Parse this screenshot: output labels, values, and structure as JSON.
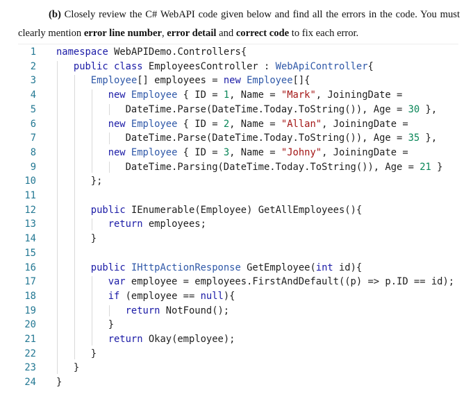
{
  "question": {
    "label": "(b)",
    "text_before": " Closely review the C# WebAPI code given below and find all the errors in the code. You must",
    "text_line2_start": "clearly mention ",
    "bold1": "error line number",
    "sep1": ", ",
    "bold2": "error detail",
    "sep2": " and ",
    "bold3": "correct code",
    "text_end": " to fix each error."
  },
  "code": {
    "language": "C#",
    "lines": [
      {
        "n": "1",
        "indent": 0,
        "tokens": [
          [
            "kw",
            "namespace"
          ],
          [
            "",
            " WebAPIDemo.Controllers{"
          ]
        ]
      },
      {
        "n": "2",
        "indent": 1,
        "tokens": [
          [
            "kw",
            "public class"
          ],
          [
            "",
            " EmployeesController : "
          ],
          [
            "ty",
            "WebApiController"
          ],
          [
            "",
            "{"
          ]
        ]
      },
      {
        "n": "3",
        "indent": 2,
        "tokens": [
          [
            "ty",
            "Employee"
          ],
          [
            "",
            "[] employees = "
          ],
          [
            "kw",
            "new"
          ],
          [
            "",
            " "
          ],
          [
            "ty",
            "Employee"
          ],
          [
            "",
            "[]{"
          ]
        ]
      },
      {
        "n": "4",
        "indent": 3,
        "tokens": [
          [
            "kw",
            "new"
          ],
          [
            "",
            " "
          ],
          [
            "ty",
            "Employee"
          ],
          [
            "",
            " { ID = "
          ],
          [
            "num",
            "1"
          ],
          [
            "",
            ", Name = "
          ],
          [
            "str",
            "\"Mark\""
          ],
          [
            "",
            ", JoiningDate ="
          ]
        ]
      },
      {
        "n": "5",
        "indent": 4,
        "tokens": [
          [
            "",
            "DateTime.Parse(DateTime.Today.ToString()), Age = "
          ],
          [
            "num",
            "30"
          ],
          [
            "",
            " },"
          ]
        ]
      },
      {
        "n": "6",
        "indent": 3,
        "tokens": [
          [
            "kw",
            "new"
          ],
          [
            "",
            " "
          ],
          [
            "ty",
            "Employee"
          ],
          [
            "",
            " { ID = "
          ],
          [
            "num",
            "2"
          ],
          [
            "",
            ", Name = "
          ],
          [
            "str",
            "\"Allan\""
          ],
          [
            "",
            ", JoiningDate ="
          ]
        ]
      },
      {
        "n": "7",
        "indent": 4,
        "tokens": [
          [
            "",
            "DateTime.Parse(DateTime.Today.ToString()), Age = "
          ],
          [
            "num",
            "35"
          ],
          [
            "",
            " },"
          ]
        ]
      },
      {
        "n": "8",
        "indent": 3,
        "tokens": [
          [
            "kw",
            "new"
          ],
          [
            "",
            " "
          ],
          [
            "ty",
            "Employee"
          ],
          [
            "",
            " { ID = "
          ],
          [
            "num",
            "3"
          ],
          [
            "",
            ", Name = "
          ],
          [
            "str",
            "\"Johny\""
          ],
          [
            "",
            ", JoiningDate ="
          ]
        ]
      },
      {
        "n": "9",
        "indent": 4,
        "tokens": [
          [
            "",
            "DateTime.Parsing(DateTime.Today.ToString()), Age = "
          ],
          [
            "num",
            "21"
          ],
          [
            "",
            " }"
          ]
        ]
      },
      {
        "n": "10",
        "indent": 2,
        "tokens": [
          [
            "",
            "};"
          ]
        ]
      },
      {
        "n": "11",
        "indent": 0,
        "tokens": []
      },
      {
        "n": "12",
        "indent": 2,
        "tokens": [
          [
            "kw",
            "public"
          ],
          [
            "",
            " IEnumerable(Employee) GetAllEmployees(){"
          ]
        ]
      },
      {
        "n": "13",
        "indent": 3,
        "tokens": [
          [
            "kw",
            "return"
          ],
          [
            "",
            " employees;"
          ]
        ]
      },
      {
        "n": "14",
        "indent": 2,
        "tokens": [
          [
            "",
            "}"
          ]
        ]
      },
      {
        "n": "15",
        "indent": 0,
        "tokens": []
      },
      {
        "n": "16",
        "indent": 2,
        "tokens": [
          [
            "kw",
            "public"
          ],
          [
            "",
            " "
          ],
          [
            "ty",
            "IHttpActionResponse"
          ],
          [
            "",
            " GetEmployee("
          ],
          [
            "kw",
            "int"
          ],
          [
            "",
            " id){"
          ]
        ]
      },
      {
        "n": "17",
        "indent": 3,
        "tokens": [
          [
            "kw",
            "var"
          ],
          [
            "",
            " employee = employees.FirstAndDefault((p) => p.ID == id);"
          ]
        ]
      },
      {
        "n": "18",
        "indent": 3,
        "tokens": [
          [
            "kw",
            "if"
          ],
          [
            "",
            " (employee == "
          ],
          [
            "kw",
            "null"
          ],
          [
            "",
            "){"
          ]
        ]
      },
      {
        "n": "19",
        "indent": 4,
        "tokens": [
          [
            "kw",
            "return"
          ],
          [
            "",
            " NotFound();"
          ]
        ]
      },
      {
        "n": "20",
        "indent": 3,
        "tokens": [
          [
            "",
            "}"
          ]
        ]
      },
      {
        "n": "21",
        "indent": 3,
        "tokens": [
          [
            "kw",
            "return"
          ],
          [
            "",
            " Okay(employee);"
          ]
        ]
      },
      {
        "n": "22",
        "indent": 2,
        "tokens": [
          [
            "",
            "}"
          ]
        ]
      },
      {
        "n": "23",
        "indent": 1,
        "tokens": [
          [
            "",
            "}"
          ]
        ]
      },
      {
        "n": "24",
        "indent": 0,
        "tokens": [
          [
            "",
            "}"
          ]
        ]
      }
    ]
  },
  "colors": {
    "keyword": "#1a1aa6",
    "type": "#2f58a8",
    "string": "#a31515",
    "number": "#098658",
    "line_number": "#237893"
  }
}
